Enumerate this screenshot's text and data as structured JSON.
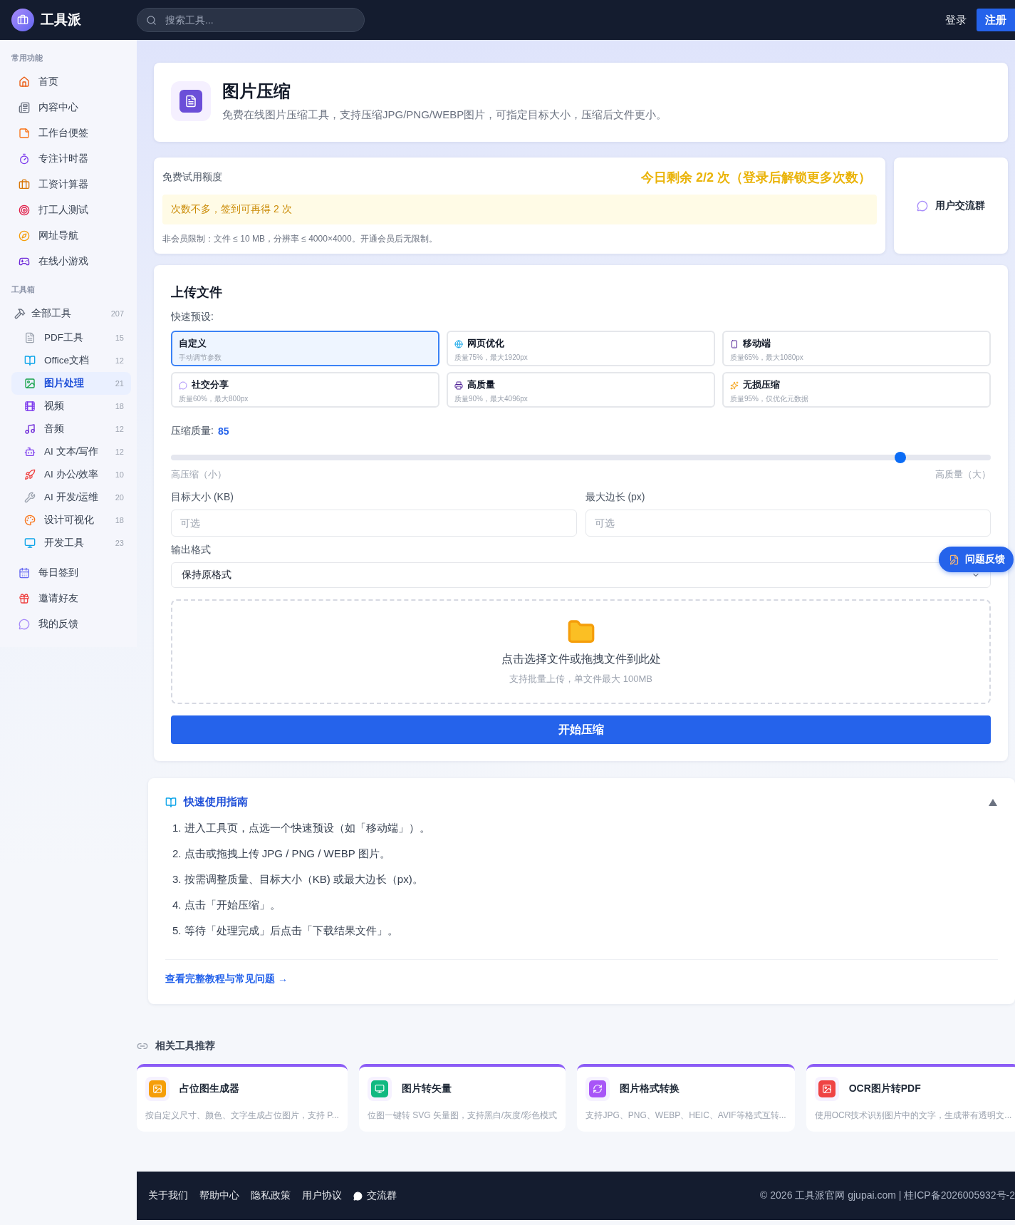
{
  "header": {
    "logo": "工具派",
    "search_placeholder": "搜索工具...",
    "login": "登录",
    "register": "注册"
  },
  "sidebar": {
    "common_title": "常用功能",
    "common": [
      {
        "label": "首页",
        "selected": false
      },
      {
        "label": "内容中心",
        "selected": false
      },
      {
        "label": "工作台便签",
        "selected": false
      },
      {
        "label": "专注计时器",
        "selected": false
      },
      {
        "label": "工资计算器",
        "selected": false
      },
      {
        "label": "打工人测试",
        "selected": false
      },
      {
        "label": "网址导航",
        "selected": false
      },
      {
        "label": "在线小游戏",
        "selected": false
      }
    ],
    "tools_title": "工具箱",
    "tools": {
      "label": "全部工具",
      "count": "207",
      "selected": false,
      "children": [
        {
          "label": "PDF工具",
          "count": "15",
          "selected": false
        },
        {
          "label": "Office文档",
          "count": "12",
          "selected": false
        },
        {
          "label": "图片处理",
          "count": "21",
          "selected": true
        },
        {
          "label": "视频",
          "count": "18",
          "selected": false
        },
        {
          "label": "音频",
          "count": "12",
          "selected": false
        },
        {
          "label": "AI 文本/写作",
          "count": "12",
          "selected": false
        },
        {
          "label": "AI 办公/效率",
          "count": "10",
          "selected": false
        },
        {
          "label": "AI 开发/运维",
          "count": "20",
          "selected": false
        },
        {
          "label": "设计可视化",
          "count": "18",
          "selected": false
        },
        {
          "label": "开发工具",
          "count": "23",
          "selected": false
        }
      ]
    },
    "bottom": [
      {
        "label": "每日签到",
        "selected": false
      },
      {
        "label": "邀请好友",
        "selected": false
      },
      {
        "label": "我的反馈",
        "selected": false
      }
    ]
  },
  "tool": {
    "title": "图片压缩",
    "description": "免费在线图片压缩工具，支持压缩JPG/PNG/WEBP图片，可指定目标大小，压缩后文件更小。"
  },
  "quota": {
    "label": "免费试用额度",
    "remaining": "今日剩余 2/2 次（登录后解锁更多次数）",
    "notice": "次数不多，签到可再得 2 次",
    "limits": "非会员限制：文件 ≤ 10 MB，分辨率 ≤ 4000×4000。开通会员后无限制。"
  },
  "group_button": "用户交流群",
  "upload": {
    "title": "上传文件",
    "presets_label": "快速预设:",
    "presets": [
      {
        "name": "自定义",
        "desc": "手动调节参数",
        "selected": true
      },
      {
        "name": "网页优化",
        "desc": "质量75%，最大1920px",
        "selected": false
      },
      {
        "name": "移动端",
        "desc": "质量65%，最大1080px",
        "selected": false
      },
      {
        "name": "社交分享",
        "desc": "质量60%，最大800px",
        "selected": false
      },
      {
        "name": "高质量",
        "desc": "质量90%，最大4096px",
        "selected": false
      },
      {
        "name": "无损压缩",
        "desc": "质量95%，仅优化元数据",
        "selected": false
      }
    ],
    "quality_label": "压缩质量:",
    "quality_value": "85",
    "quality": {
      "level": 0.89
    },
    "low_label": "高压缩（小）",
    "high_label": "高质量（大）",
    "target_label": "目标大小 (KB)",
    "target_placeholder": "可选",
    "maxside_label": "最大边长 (px)",
    "maxside_placeholder": "可选",
    "format_label": "输出格式",
    "format_value": "保持原格式",
    "drop_text": "点击选择文件或拖拽文件到此处",
    "drop_hint": "支持批量上传，单文件最大 100MB",
    "submit": "开始压缩"
  },
  "feedback_button": "问题反馈",
  "guide": {
    "title": "快速使用指南",
    "expanded": true,
    "steps": [
      "1. 进入工具页，点选一个快速预设（如「移动端」）。",
      "2. 点击或拖拽上传 JPG / PNG / WEBP 图片。",
      "3. 按需调整质量、目标大小（KB) 或最大边长（px)。",
      "4. 点击「开始压缩」。",
      "5. 等待「处理完成」后点击「下载结果文件」。"
    ],
    "link": "查看完整教程与常见问题 →"
  },
  "related": {
    "title": "相关工具推荐",
    "cards": [
      {
        "name": "占位图生成器",
        "desc": "按自定义尺寸、颜色、文字生成占位图片，支持 P..."
      },
      {
        "name": "图片转矢量",
        "desc": "位图一键转 SVG 矢量图，支持黑白/灰度/彩色模式"
      },
      {
        "name": "图片格式转换",
        "desc": "支持JPG、PNG、WEBP、HEIC、AVIF等格式互转..."
      },
      {
        "name": "OCR图片转PDF",
        "desc": "使用OCR技术识别图片中的文字，生成带有透明文..."
      }
    ]
  },
  "footer": {
    "links": [
      "关于我们",
      "帮助中心",
      "隐私政策",
      "用户协议"
    ],
    "group": "交流群",
    "copyright": "© 2026 工具派官网 gjupai.com | 桂ICP备2026005932号-2"
  }
}
